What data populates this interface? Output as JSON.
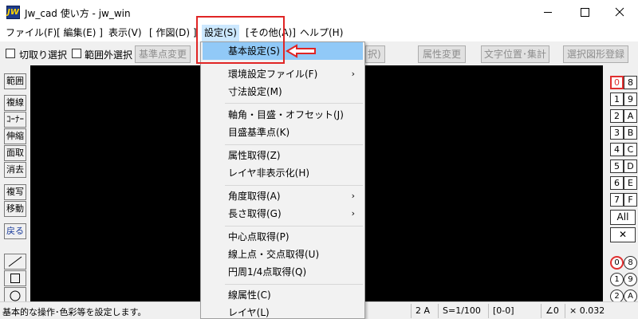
{
  "window": {
    "title": "Jw_cad 使い方 - jw_win",
    "icon_text": "JW"
  },
  "menubar": {
    "items": [
      {
        "label": "ファイル(F)"
      },
      {
        "label": "[ 編集(E) ]"
      },
      {
        "label": "表示(V)"
      },
      {
        "label": "[ 作図(D) ]"
      },
      {
        "label": "設定(S)"
      },
      {
        "label": "[その他(A)]"
      },
      {
        "label": "ヘルプ(H)"
      }
    ],
    "active": "設定(S)"
  },
  "toolbar": {
    "checkbox1_label": "切取り選択",
    "checkbox2_label": "範囲外選択",
    "btn_base_point": "基準点変更",
    "btn_partial": "択)",
    "btn_attr_change": "属性変更",
    "btn_text_pos": "文字位置･集計",
    "btn_register": "選択図形登録"
  },
  "left_tools": [
    {
      "label": "範囲"
    },
    {
      "label": "複線"
    },
    {
      "label": "ｺｰﾅｰ"
    },
    {
      "label": "伸縮"
    },
    {
      "label": "面取"
    },
    {
      "label": "消去"
    },
    {
      "label": "複写"
    },
    {
      "label": "移動"
    },
    {
      "label": "戻る"
    }
  ],
  "layer_groups": {
    "left": [
      "0",
      "1",
      "2",
      "3",
      "4",
      "5",
      "6",
      "7"
    ],
    "right": [
      "8",
      "9",
      "A",
      "B",
      "C",
      "D",
      "E",
      "F"
    ],
    "all_label": "All",
    "cross_label": "✕"
  },
  "layer_circles": {
    "left": [
      "0",
      "1",
      "2"
    ],
    "right": [
      "8",
      "9",
      "A"
    ]
  },
  "dropdown": {
    "items": [
      {
        "label": "基本設定(S)",
        "highlight": true
      },
      {
        "label": "環境設定ファイル(F)",
        "submenu": true
      },
      {
        "label": "寸法設定(M)"
      },
      {
        "label": "軸角・目盛・オフセット(J)"
      },
      {
        "label": "目盛基準点(K)"
      },
      {
        "label": "属性取得(Z)"
      },
      {
        "label": "レイヤ非表示化(H)"
      },
      {
        "label": "角度取得(A)",
        "submenu": true
      },
      {
        "label": "長さ取得(G)",
        "submenu": true
      },
      {
        "label": "中心点取得(P)"
      },
      {
        "label": "線上点・交点取得(U)"
      },
      {
        "label": "円周1/4点取得(Q)"
      },
      {
        "label": "線属性(C)"
      },
      {
        "label": "レイヤ(L)"
      }
    ],
    "submenu_arrow": "›"
  },
  "statusbar": {
    "message": "基本的な操作･色彩等を設定します。",
    "layer": "2 A",
    "scale": "S=1/100",
    "group": "[0-0]",
    "angle": "∠0",
    "ratio": "× 0.032"
  },
  "colors": {
    "accent_highlight": "#91c9f7",
    "menu_active": "#cce8ff",
    "annotation_red": "#e02525",
    "canvas": "#000000",
    "tool_blue": "#1a3c9c"
  }
}
